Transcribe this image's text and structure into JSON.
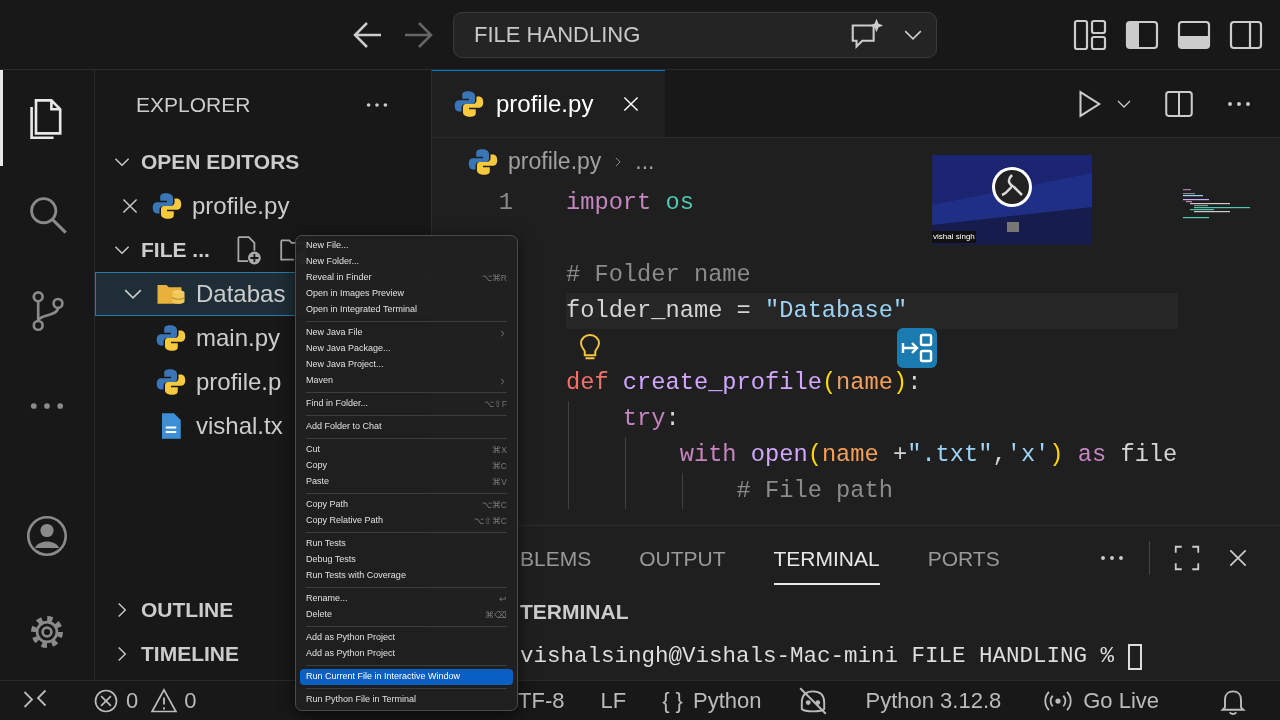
{
  "title_bar": {
    "search": "FILE HANDLING"
  },
  "activity_bar": {
    "top": [
      {
        "kind": "explorer",
        "selected": true
      },
      {
        "kind": "search",
        "selected": false
      },
      {
        "kind": "source-control",
        "selected": false
      },
      {
        "kind": "more",
        "selected": false
      }
    ],
    "bottom": [
      {
        "kind": "account"
      },
      {
        "kind": "settings"
      }
    ]
  },
  "sidebar": {
    "title": "EXPLORER",
    "sections": [
      {
        "label": "OPEN EDITORS",
        "expanded": true,
        "items": [
          {
            "name": "profile.py",
            "kind": "python",
            "selected": false
          }
        ]
      },
      {
        "label": "FILE ...",
        "expanded": true,
        "items": [
          {
            "name": "Databas",
            "kind": "folder",
            "expanded": true,
            "selected": true
          },
          {
            "name": "main.py",
            "kind": "python",
            "selected": false
          },
          {
            "name": "profile.p",
            "kind": "python",
            "selected": false
          },
          {
            "name": "vishal.tx",
            "kind": "text",
            "selected": false
          }
        ]
      },
      {
        "label": "OUTLINE",
        "expanded": false
      },
      {
        "label": "TIMELINE",
        "expanded": false
      }
    ]
  },
  "editor": {
    "tabs": [
      {
        "label": "profile.py",
        "kind": "python",
        "selected": true
      }
    ],
    "breadcrumb": [
      "profile.py",
      "..."
    ],
    "lines": [
      {
        "kind": "code",
        "number": "1",
        "highlighted": false,
        "tokens": [
          {
            "t": "import",
            "kind": "keyword"
          },
          {
            "t": " os",
            "kind": "module"
          }
        ]
      },
      {
        "kind": "blank"
      },
      {
        "kind": "code",
        "highlighted": false,
        "tokens": [
          {
            "t": "# Folder name",
            "kind": "comment"
          }
        ]
      },
      {
        "kind": "code",
        "highlighted": true,
        "tokens": [
          {
            "t": "folder_name = ",
            "kind": "plain"
          },
          {
            "t": "\"Database\"",
            "kind": "string"
          }
        ]
      },
      {
        "kind": "lightbulb"
      },
      {
        "kind": "code",
        "highlighted": false,
        "tokens": [
          {
            "t": "def",
            "kind": "def"
          },
          {
            "t": " create_profile",
            "kind": "function"
          },
          {
            "t": "(",
            "kind": "paren"
          },
          {
            "t": "name",
            "kind": "param"
          },
          {
            "t": ")",
            "kind": "paren"
          },
          {
            "t": ":",
            "kind": "plain"
          }
        ]
      },
      {
        "kind": "code",
        "highlighted": false,
        "tokens": [
          {
            "t": "    try",
            "kind": "keyword"
          },
          {
            "t": ":",
            "kind": "plain"
          }
        ]
      },
      {
        "kind": "code",
        "highlighted": false,
        "tokens": [
          {
            "t": "        with",
            "kind": "keyword"
          },
          {
            "t": " open",
            "kind": "function"
          },
          {
            "t": "(",
            "kind": "paren"
          },
          {
            "t": "name",
            "kind": "param"
          },
          {
            "t": " +",
            "kind": "plain"
          },
          {
            "t": "\".txt\"",
            "kind": "string"
          },
          {
            "t": ",",
            "kind": "plain"
          },
          {
            "t": "'x'",
            "kind": "string"
          },
          {
            "t": ")",
            "kind": "paren"
          },
          {
            "t": " as",
            "kind": "keyword"
          },
          {
            "t": " file",
            "kind": "plain"
          }
        ]
      },
      {
        "kind": "code",
        "highlighted": false,
        "tokens": [
          {
            "t": "            # File path",
            "kind": "comment"
          }
        ]
      }
    ],
    "camera": {
      "caption": "vishal singh"
    }
  },
  "panel": {
    "tabs": [
      {
        "label": "BLEMS",
        "selected": false
      },
      {
        "label": "OUTPUT",
        "selected": false
      },
      {
        "label": "TERMINAL",
        "selected": true
      },
      {
        "label": "PORTS",
        "selected": false
      }
    ],
    "terminal_title": "TERMINAL",
    "prompt": "vishalsingh@Vishals-Mac-mini FILE HANDLING % "
  },
  "status_bar": {
    "errors": "0",
    "warnings": "0",
    "items": [
      {
        "kind": "text",
        "text": "TF-8"
      },
      {
        "kind": "text",
        "text": "LF"
      },
      {
        "kind": "language",
        "symbol": "{ }",
        "text": "Python"
      },
      {
        "kind": "copilot-off"
      },
      {
        "kind": "text",
        "text": "Python 3.12.8"
      },
      {
        "kind": "live",
        "text": "Go Live"
      },
      {
        "kind": "bell"
      }
    ]
  },
  "context_menu": {
    "groups": [
      [
        {
          "label": "New File...",
          "submenu": false,
          "selected": false
        },
        {
          "label": "New Folder...",
          "submenu": false,
          "selected": false
        },
        {
          "label": "Reveal in Finder",
          "shortcut": "⌥⌘R",
          "submenu": false,
          "selected": false
        },
        {
          "label": "Open in Images Preview",
          "submenu": false,
          "selected": false
        },
        {
          "label": "Open in Integrated Terminal",
          "submenu": false,
          "selected": false
        }
      ],
      [
        {
          "label": "New Java File",
          "submenu": true,
          "selected": false
        },
        {
          "label": "New Java Package...",
          "submenu": false,
          "selected": false
        },
        {
          "label": "New Java Project...",
          "submenu": false,
          "selected": false
        },
        {
          "label": "Maven",
          "submenu": true,
          "selected": false
        }
      ],
      [
        {
          "label": "Find in Folder...",
          "shortcut": "⌥⇧F",
          "submenu": false,
          "selected": false
        }
      ],
      [
        {
          "label": "Add Folder to Chat",
          "submenu": false,
          "selected": false
        }
      ],
      [
        {
          "label": "Cut",
          "shortcut": "⌘X",
          "submenu": false,
          "selected": false
        },
        {
          "label": "Copy",
          "shortcut": "⌘C",
          "submenu": false,
          "selected": false
        },
        {
          "label": "Paste",
          "shortcut": "⌘V",
          "submenu": false,
          "selected": false
        }
      ],
      [
        {
          "label": "Copy Path",
          "shortcut": "⌥⌘C",
          "submenu": false,
          "selected": false
        },
        {
          "label": "Copy Relative Path",
          "shortcut": "⌥⇧⌘C",
          "submenu": false,
          "selected": false
        }
      ],
      [
        {
          "label": "Run Tests",
          "submenu": false,
          "selected": false
        },
        {
          "label": "Debug Tests",
          "submenu": false,
          "selected": false
        },
        {
          "label": "Run Tests with Coverage",
          "submenu": false,
          "selected": false
        }
      ],
      [
        {
          "label": "Rename...",
          "shortcut": "↩",
          "submenu": false,
          "selected": false
        },
        {
          "label": "Delete",
          "shortcut": "⌘⌫",
          "submenu": false,
          "selected": false
        }
      ],
      [
        {
          "label": "Add as Python Project",
          "submenu": false,
          "selected": false
        },
        {
          "label": "Add as Python Project",
          "submenu": false,
          "selected": false
        }
      ],
      [
        {
          "label": "Run Current File in Interactive Window",
          "submenu": false,
          "selected": true
        }
      ],
      [
        {
          "label": "Run Python File in Terminal",
          "submenu": false,
          "selected": false
        }
      ]
    ]
  }
}
